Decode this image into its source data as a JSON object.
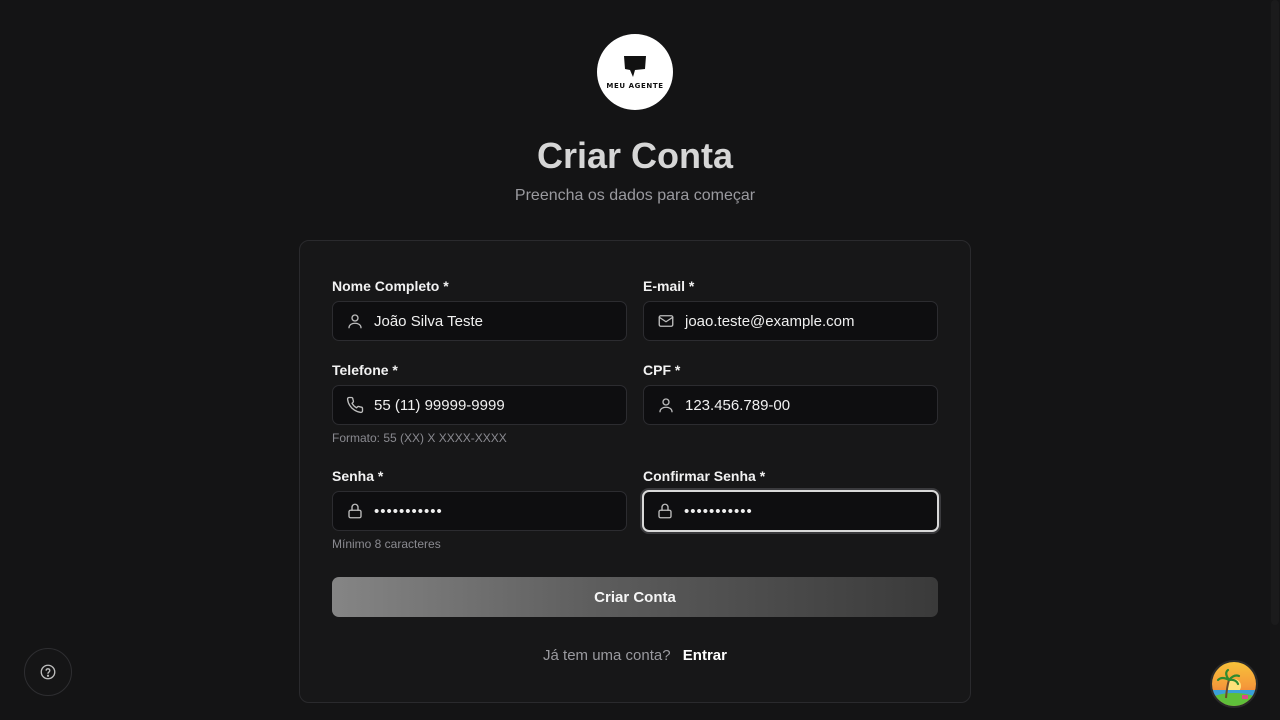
{
  "logo": {
    "text": "MEU AGENTE"
  },
  "header": {
    "title": "Criar Conta",
    "subtitle": "Preencha os dados para começar"
  },
  "form": {
    "fields": {
      "name": {
        "label": "Nome Completo *",
        "value": "João Silva Teste",
        "icon": "user-icon"
      },
      "email": {
        "label": "E-mail *",
        "value": "joao.teste@example.com",
        "icon": "mail-icon"
      },
      "phone": {
        "label": "Telefone *",
        "value": "55 (11) 99999-9999",
        "icon": "phone-icon",
        "hint": "Formato: 55 (XX) X XXXX-XXXX"
      },
      "cpf": {
        "label": "CPF *",
        "value": "123.456.789-00",
        "icon": "user-icon"
      },
      "password": {
        "label": "Senha *",
        "value": "•••••••••••",
        "icon": "lock-icon",
        "hint": "Mínimo 8 caracteres"
      },
      "confirm_password": {
        "label": "Confirmar Senha *",
        "value": "•••••••••••",
        "icon": "lock-icon",
        "focused": true
      }
    },
    "submit_label": "Criar Conta",
    "login_prompt": "Já tem uma conta?",
    "login_link": "Entrar"
  },
  "help": {
    "icon": "help-circle-icon"
  },
  "avatar": {
    "icon": "beach-avatar"
  }
}
